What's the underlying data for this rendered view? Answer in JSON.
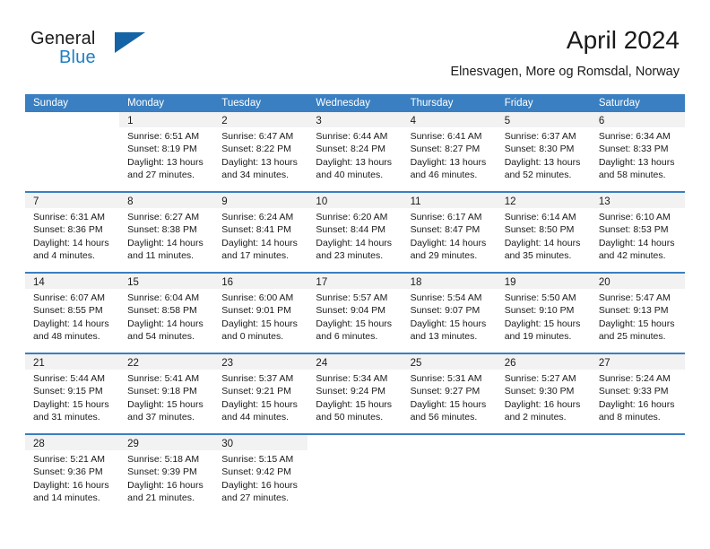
{
  "brand": {
    "name_part1": "General",
    "name_part2": "Blue",
    "triangle_color": "#1464a5",
    "blue_text_color": "#1f7fc4"
  },
  "header": {
    "title": "April 2024",
    "subtitle": "Elnesvagen, More og Romsdal, Norway"
  },
  "theme": {
    "header_band_color": "#3a7fc1",
    "day_band_color": "#f2f2f2",
    "text_color": "#1a1a1a"
  },
  "weekdays": [
    "Sunday",
    "Monday",
    "Tuesday",
    "Wednesday",
    "Thursday",
    "Friday",
    "Saturday"
  ],
  "weeks": [
    [
      {
        "day": "",
        "sunrise": "",
        "sunset": "",
        "daylight_1": "",
        "daylight_2": ""
      },
      {
        "day": "1",
        "sunrise": "Sunrise: 6:51 AM",
        "sunset": "Sunset: 8:19 PM",
        "daylight_1": "Daylight: 13 hours",
        "daylight_2": "and 27 minutes."
      },
      {
        "day": "2",
        "sunrise": "Sunrise: 6:47 AM",
        "sunset": "Sunset: 8:22 PM",
        "daylight_1": "Daylight: 13 hours",
        "daylight_2": "and 34 minutes."
      },
      {
        "day": "3",
        "sunrise": "Sunrise: 6:44 AM",
        "sunset": "Sunset: 8:24 PM",
        "daylight_1": "Daylight: 13 hours",
        "daylight_2": "and 40 minutes."
      },
      {
        "day": "4",
        "sunrise": "Sunrise: 6:41 AM",
        "sunset": "Sunset: 8:27 PM",
        "daylight_1": "Daylight: 13 hours",
        "daylight_2": "and 46 minutes."
      },
      {
        "day": "5",
        "sunrise": "Sunrise: 6:37 AM",
        "sunset": "Sunset: 8:30 PM",
        "daylight_1": "Daylight: 13 hours",
        "daylight_2": "and 52 minutes."
      },
      {
        "day": "6",
        "sunrise": "Sunrise: 6:34 AM",
        "sunset": "Sunset: 8:33 PM",
        "daylight_1": "Daylight: 13 hours",
        "daylight_2": "and 58 minutes."
      }
    ],
    [
      {
        "day": "7",
        "sunrise": "Sunrise: 6:31 AM",
        "sunset": "Sunset: 8:36 PM",
        "daylight_1": "Daylight: 14 hours",
        "daylight_2": "and 4 minutes."
      },
      {
        "day": "8",
        "sunrise": "Sunrise: 6:27 AM",
        "sunset": "Sunset: 8:38 PM",
        "daylight_1": "Daylight: 14 hours",
        "daylight_2": "and 11 minutes."
      },
      {
        "day": "9",
        "sunrise": "Sunrise: 6:24 AM",
        "sunset": "Sunset: 8:41 PM",
        "daylight_1": "Daylight: 14 hours",
        "daylight_2": "and 17 minutes."
      },
      {
        "day": "10",
        "sunrise": "Sunrise: 6:20 AM",
        "sunset": "Sunset: 8:44 PM",
        "daylight_1": "Daylight: 14 hours",
        "daylight_2": "and 23 minutes."
      },
      {
        "day": "11",
        "sunrise": "Sunrise: 6:17 AM",
        "sunset": "Sunset: 8:47 PM",
        "daylight_1": "Daylight: 14 hours",
        "daylight_2": "and 29 minutes."
      },
      {
        "day": "12",
        "sunrise": "Sunrise: 6:14 AM",
        "sunset": "Sunset: 8:50 PM",
        "daylight_1": "Daylight: 14 hours",
        "daylight_2": "and 35 minutes."
      },
      {
        "day": "13",
        "sunrise": "Sunrise: 6:10 AM",
        "sunset": "Sunset: 8:53 PM",
        "daylight_1": "Daylight: 14 hours",
        "daylight_2": "and 42 minutes."
      }
    ],
    [
      {
        "day": "14",
        "sunrise": "Sunrise: 6:07 AM",
        "sunset": "Sunset: 8:55 PM",
        "daylight_1": "Daylight: 14 hours",
        "daylight_2": "and 48 minutes."
      },
      {
        "day": "15",
        "sunrise": "Sunrise: 6:04 AM",
        "sunset": "Sunset: 8:58 PM",
        "daylight_1": "Daylight: 14 hours",
        "daylight_2": "and 54 minutes."
      },
      {
        "day": "16",
        "sunrise": "Sunrise: 6:00 AM",
        "sunset": "Sunset: 9:01 PM",
        "daylight_1": "Daylight: 15 hours",
        "daylight_2": "and 0 minutes."
      },
      {
        "day": "17",
        "sunrise": "Sunrise: 5:57 AM",
        "sunset": "Sunset: 9:04 PM",
        "daylight_1": "Daylight: 15 hours",
        "daylight_2": "and 6 minutes."
      },
      {
        "day": "18",
        "sunrise": "Sunrise: 5:54 AM",
        "sunset": "Sunset: 9:07 PM",
        "daylight_1": "Daylight: 15 hours",
        "daylight_2": "and 13 minutes."
      },
      {
        "day": "19",
        "sunrise": "Sunrise: 5:50 AM",
        "sunset": "Sunset: 9:10 PM",
        "daylight_1": "Daylight: 15 hours",
        "daylight_2": "and 19 minutes."
      },
      {
        "day": "20",
        "sunrise": "Sunrise: 5:47 AM",
        "sunset": "Sunset: 9:13 PM",
        "daylight_1": "Daylight: 15 hours",
        "daylight_2": "and 25 minutes."
      }
    ],
    [
      {
        "day": "21",
        "sunrise": "Sunrise: 5:44 AM",
        "sunset": "Sunset: 9:15 PM",
        "daylight_1": "Daylight: 15 hours",
        "daylight_2": "and 31 minutes."
      },
      {
        "day": "22",
        "sunrise": "Sunrise: 5:41 AM",
        "sunset": "Sunset: 9:18 PM",
        "daylight_1": "Daylight: 15 hours",
        "daylight_2": "and 37 minutes."
      },
      {
        "day": "23",
        "sunrise": "Sunrise: 5:37 AM",
        "sunset": "Sunset: 9:21 PM",
        "daylight_1": "Daylight: 15 hours",
        "daylight_2": "and 44 minutes."
      },
      {
        "day": "24",
        "sunrise": "Sunrise: 5:34 AM",
        "sunset": "Sunset: 9:24 PM",
        "daylight_1": "Daylight: 15 hours",
        "daylight_2": "and 50 minutes."
      },
      {
        "day": "25",
        "sunrise": "Sunrise: 5:31 AM",
        "sunset": "Sunset: 9:27 PM",
        "daylight_1": "Daylight: 15 hours",
        "daylight_2": "and 56 minutes."
      },
      {
        "day": "26",
        "sunrise": "Sunrise: 5:27 AM",
        "sunset": "Sunset: 9:30 PM",
        "daylight_1": "Daylight: 16 hours",
        "daylight_2": "and 2 minutes."
      },
      {
        "day": "27",
        "sunrise": "Sunrise: 5:24 AM",
        "sunset": "Sunset: 9:33 PM",
        "daylight_1": "Daylight: 16 hours",
        "daylight_2": "and 8 minutes."
      }
    ],
    [
      {
        "day": "28",
        "sunrise": "Sunrise: 5:21 AM",
        "sunset": "Sunset: 9:36 PM",
        "daylight_1": "Daylight: 16 hours",
        "daylight_2": "and 14 minutes."
      },
      {
        "day": "29",
        "sunrise": "Sunrise: 5:18 AM",
        "sunset": "Sunset: 9:39 PM",
        "daylight_1": "Daylight: 16 hours",
        "daylight_2": "and 21 minutes."
      },
      {
        "day": "30",
        "sunrise": "Sunrise: 5:15 AM",
        "sunset": "Sunset: 9:42 PM",
        "daylight_1": "Daylight: 16 hours",
        "daylight_2": "and 27 minutes."
      },
      {
        "day": "",
        "sunrise": "",
        "sunset": "",
        "daylight_1": "",
        "daylight_2": ""
      },
      {
        "day": "",
        "sunrise": "",
        "sunset": "",
        "daylight_1": "",
        "daylight_2": ""
      },
      {
        "day": "",
        "sunrise": "",
        "sunset": "",
        "daylight_1": "",
        "daylight_2": ""
      },
      {
        "day": "",
        "sunrise": "",
        "sunset": "",
        "daylight_1": "",
        "daylight_2": ""
      }
    ]
  ]
}
